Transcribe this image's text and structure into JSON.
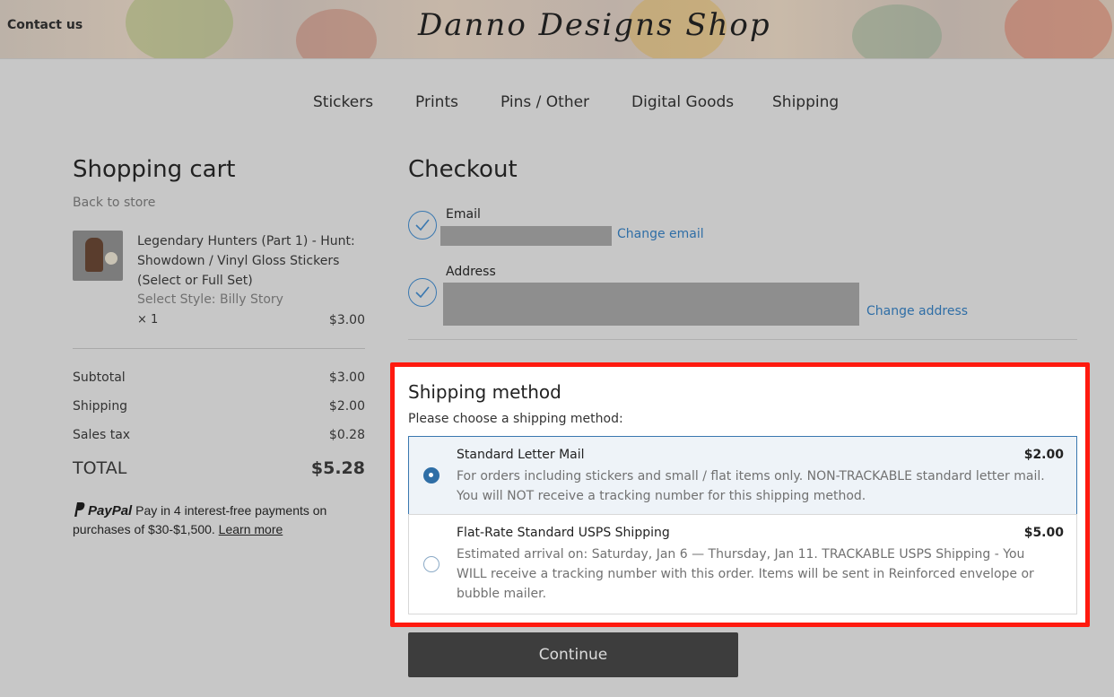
{
  "header": {
    "contact_label": "Contact us",
    "brand": "Danno Designs Shop"
  },
  "nav": {
    "items": [
      {
        "label": "Stickers"
      },
      {
        "label": "Prints"
      },
      {
        "label": "Pins / Other"
      },
      {
        "label": "Digital Goods"
      },
      {
        "label": "Shipping"
      }
    ]
  },
  "cart": {
    "title": "Shopping cart",
    "back_label": "Back to store",
    "item": {
      "name": "Legendary Hunters (Part 1) - Hunt: Showdown / Vinyl Gloss Stickers (Select or Full Set)",
      "style": "Select Style: Billy Story",
      "quantity": "× 1",
      "price": "$3.00"
    },
    "summary": {
      "subtotal_label": "Subtotal",
      "subtotal_value": "$3.00",
      "shipping_label": "Shipping",
      "shipping_value": "$2.00",
      "tax_label": "Sales tax",
      "tax_value": "$0.28",
      "total_label": "TOTAL",
      "total_value": "$5.28"
    },
    "paypal": {
      "logo_text": "PayPal",
      "message": "Pay in 4 interest-free payments on purchases of $30-$1,500.",
      "learn_more": "Learn more"
    }
  },
  "checkout": {
    "title": "Checkout",
    "email_label": "Email",
    "change_email": "Change email",
    "address_label": "Address",
    "change_address": "Change address",
    "shipping": {
      "title": "Shipping method",
      "subtitle": "Please choose a shipping method:",
      "options": [
        {
          "name": "Standard Letter Mail",
          "price": "$2.00",
          "description": "For orders including stickers and small / flat items only. NON-TRACKABLE standard letter mail. You will NOT receive a tracking number for this shipping method.",
          "selected": true
        },
        {
          "name": "Flat-Rate Standard USPS Shipping",
          "price": "$5.00",
          "description": "Estimated arrival on: Saturday, Jan 6 — Thursday, Jan 11. TRACKABLE USPS Shipping - You WILL receive a tracking number with this order. Items will be sent in Reinforced envelope or bubble mailer.",
          "selected": false
        }
      ]
    },
    "continue_label": "Continue"
  },
  "colors": {
    "accent": "#2f6ea6",
    "highlight_border": "#ff1a0f",
    "button_bg": "#3d3d3d"
  }
}
